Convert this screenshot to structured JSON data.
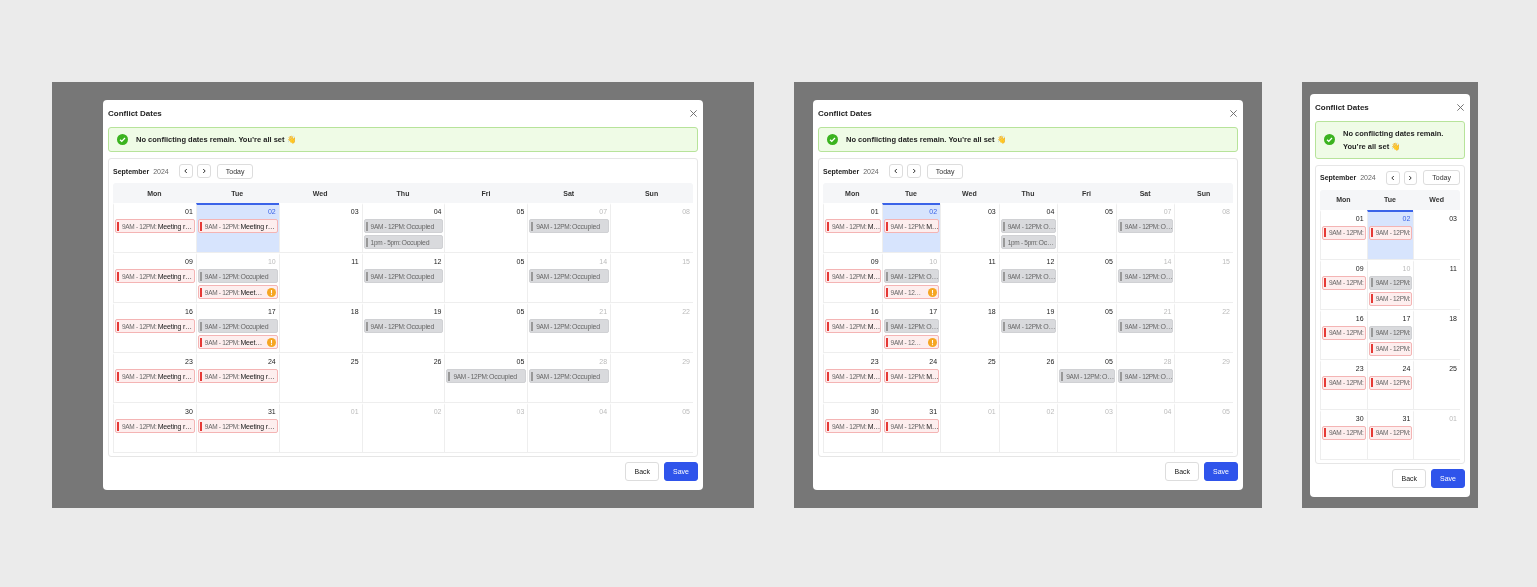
{
  "panels": [
    {
      "dialog": {
        "title": "Conflict Dates",
        "banner": "No conflicting dates remain. You’re all set 👋",
        "calendar": {
          "month": "September",
          "year": "2024",
          "today": "Today",
          "weekdays": [
            "Mon",
            "Tue",
            "Wed",
            "Thu",
            "Fri",
            "Sat",
            "Sun"
          ],
          "weeks": [
            {
              "days": [
                {
                  "day": "01",
                  "muted": false,
                  "selected": false,
                  "events": [
                    {
                      "kind": "conflict",
                      "time": "9AM - 12PM:",
                      "title": "Meeting r…"
                    }
                  ]
                },
                {
                  "day": "02",
                  "muted": false,
                  "selected": true,
                  "events": [
                    {
                      "kind": "conflict",
                      "time": "9AM - 12PM:",
                      "title": "Meeting r…"
                    }
                  ]
                },
                {
                  "day": "03",
                  "muted": false,
                  "selected": false
                },
                {
                  "day": "04",
                  "muted": false,
                  "selected": false,
                  "events": [
                    {
                      "kind": "occupied",
                      "time": "9AM - 12PM:",
                      "title": "Occupied"
                    },
                    {
                      "kind": "occupied",
                      "time": "1pm - 5pm:",
                      "title": "Occupied"
                    }
                  ]
                },
                {
                  "day": "05",
                  "muted": false,
                  "selected": false
                },
                {
                  "day": "07",
                  "muted": true,
                  "selected": false,
                  "events": [
                    {
                      "kind": "occupied",
                      "time": "9AM - 12PM:",
                      "title": "Occupied"
                    }
                  ]
                },
                {
                  "day": "08",
                  "muted": true,
                  "selected": false
                }
              ]
            },
            {
              "days": [
                {
                  "day": "09",
                  "muted": false,
                  "selected": false,
                  "events": [
                    {
                      "kind": "conflict",
                      "time": "9AM - 12PM:",
                      "title": "Meeting r…"
                    }
                  ]
                },
                {
                  "day": "10",
                  "muted": true,
                  "selected": false,
                  "events": [
                    {
                      "kind": "occupied",
                      "time": "9AM - 12PM:",
                      "title": "Occupied"
                    },
                    {
                      "kind": "conflict",
                      "time": "9AM - 12PM:",
                      "title": "Meet…",
                      "warning": true
                    }
                  ]
                },
                {
                  "day": "11",
                  "muted": false,
                  "selected": false
                },
                {
                  "day": "12",
                  "muted": false,
                  "selected": false,
                  "events": [
                    {
                      "kind": "occupied",
                      "time": "9AM - 12PM:",
                      "title": "Occupied"
                    }
                  ]
                },
                {
                  "day": "05",
                  "muted": false,
                  "selected": false
                },
                {
                  "day": "14",
                  "muted": true,
                  "selected": false,
                  "events": [
                    {
                      "kind": "occupied",
                      "time": "9AM - 12PM:",
                      "title": "Occupied"
                    }
                  ]
                },
                {
                  "day": "15",
                  "muted": true,
                  "selected": false
                }
              ]
            },
            {
              "days": [
                {
                  "day": "16",
                  "muted": false,
                  "selected": false,
                  "events": [
                    {
                      "kind": "conflict",
                      "time": "9AM - 12PM:",
                      "title": "Meeting r…"
                    }
                  ]
                },
                {
                  "day": "17",
                  "muted": false,
                  "selected": false,
                  "events": [
                    {
                      "kind": "occupied",
                      "time": "9AM - 12PM:",
                      "title": "Occupied"
                    },
                    {
                      "kind": "conflict",
                      "time": "9AM - 12PM:",
                      "title": "Meet…",
                      "warning": true
                    }
                  ]
                },
                {
                  "day": "18",
                  "muted": false,
                  "selected": false
                },
                {
                  "day": "19",
                  "muted": false,
                  "selected": false,
                  "events": [
                    {
                      "kind": "occupied",
                      "time": "9AM - 12PM:",
                      "title": "Occupied"
                    }
                  ]
                },
                {
                  "day": "05",
                  "muted": false,
                  "selected": false
                },
                {
                  "day": "21",
                  "muted": true,
                  "selected": false,
                  "events": [
                    {
                      "kind": "occupied",
                      "time": "9AM - 12PM:",
                      "title": "Occupied"
                    }
                  ]
                },
                {
                  "day": "22",
                  "muted": true,
                  "selected": false
                }
              ]
            },
            {
              "days": [
                {
                  "day": "23",
                  "muted": false,
                  "selected": false,
                  "events": [
                    {
                      "kind": "conflict",
                      "time": "9AM - 12PM:",
                      "title": "Meeting r…"
                    }
                  ]
                },
                {
                  "day": "24",
                  "muted": false,
                  "selected": false,
                  "events": [
                    {
                      "kind": "conflict",
                      "time": "9AM - 12PM:",
                      "title": "Meeting r…"
                    }
                  ]
                },
                {
                  "day": "25",
                  "muted": false,
                  "selected": false
                },
                {
                  "day": "26",
                  "muted": false,
                  "selected": false
                },
                {
                  "day": "05",
                  "muted": false,
                  "selected": false,
                  "events": [
                    {
                      "kind": "occupied",
                      "time": "9AM - 12PM:",
                      "title": "Occupied"
                    }
                  ]
                },
                {
                  "day": "28",
                  "muted": true,
                  "selected": false,
                  "events": [
                    {
                      "kind": "occupied",
                      "time": "9AM - 12PM:",
                      "title": "Occupied"
                    }
                  ]
                },
                {
                  "day": "29",
                  "muted": true,
                  "selected": false
                }
              ]
            },
            {
              "days": [
                {
                  "day": "30",
                  "muted": false,
                  "selected": false,
                  "events": [
                    {
                      "kind": "conflict",
                      "time": "9AM - 12PM:",
                      "title": "Meeting r…"
                    }
                  ]
                },
                {
                  "day": "31",
                  "muted": false,
                  "selected": false,
                  "events": [
                    {
                      "kind": "conflict",
                      "time": "9AM - 12PM:",
                      "title": "Meeting r…"
                    }
                  ]
                },
                {
                  "day": "01",
                  "muted": true,
                  "selected": false
                },
                {
                  "day": "02",
                  "muted": true,
                  "selected": false
                },
                {
                  "day": "03",
                  "muted": true,
                  "selected": false
                },
                {
                  "day": "04",
                  "muted": true,
                  "selected": false
                },
                {
                  "day": "05",
                  "muted": true,
                  "selected": false
                }
              ]
            }
          ]
        },
        "buttons": [
          "Back",
          "Save"
        ]
      }
    },
    {
      "dialog": {
        "title": "Conflict Dates",
        "banner": "No conflicting dates remain. You’re all set 👋",
        "calendar": {
          "month": "September",
          "year": "2024",
          "today": "Today",
          "weekdays": [
            "Mon",
            "Tue",
            "Wed",
            "Thu",
            "Fri",
            "Sat",
            "Sun"
          ],
          "weeks": [
            {
              "days": [
                {
                  "day": "01",
                  "muted": false,
                  "selected": false,
                  "events": [
                    {
                      "kind": "conflict",
                      "time": "9AM - 12PM:",
                      "title": "M…"
                    }
                  ]
                },
                {
                  "day": "02",
                  "muted": false,
                  "selected": true,
                  "events": [
                    {
                      "kind": "conflict",
                      "time": "9AM - 12PM:",
                      "title": "M…"
                    }
                  ]
                },
                {
                  "day": "03",
                  "muted": false,
                  "selected": false
                },
                {
                  "day": "04",
                  "muted": false,
                  "selected": false,
                  "events": [
                    {
                      "kind": "occupied",
                      "time": "9AM - 12PM:",
                      "title": "O…"
                    },
                    {
                      "kind": "occupied",
                      "time": "1pm - 5pm:",
                      "title": "Oc…"
                    }
                  ]
                },
                {
                  "day": "05",
                  "muted": false,
                  "selected": false
                },
                {
                  "day": "07",
                  "muted": true,
                  "selected": false,
                  "events": [
                    {
                      "kind": "occupied",
                      "time": "9AM - 12PM:",
                      "title": "O…"
                    }
                  ]
                },
                {
                  "day": "08",
                  "muted": true,
                  "selected": false
                }
              ]
            },
            {
              "days": [
                {
                  "day": "09",
                  "muted": false,
                  "selected": false,
                  "events": [
                    {
                      "kind": "conflict",
                      "time": "9AM - 12PM:",
                      "title": "M…"
                    }
                  ]
                },
                {
                  "day": "10",
                  "muted": true,
                  "selected": false,
                  "events": [
                    {
                      "kind": "occupied",
                      "time": "9AM - 12PM:",
                      "title": "O…"
                    },
                    {
                      "kind": "conflict",
                      "time": "9AM - 12…",
                      "warning": true
                    }
                  ]
                },
                {
                  "day": "11",
                  "muted": false,
                  "selected": false
                },
                {
                  "day": "12",
                  "muted": false,
                  "selected": false,
                  "events": [
                    {
                      "kind": "occupied",
                      "time": "9AM - 12PM:",
                      "title": "O…"
                    }
                  ]
                },
                {
                  "day": "05",
                  "muted": false,
                  "selected": false
                },
                {
                  "day": "14",
                  "muted": true,
                  "selected": false,
                  "events": [
                    {
                      "kind": "occupied",
                      "time": "9AM - 12PM:",
                      "title": "O…"
                    }
                  ]
                },
                {
                  "day": "15",
                  "muted": true,
                  "selected": false
                }
              ]
            },
            {
              "days": [
                {
                  "day": "16",
                  "muted": false,
                  "selected": false,
                  "events": [
                    {
                      "kind": "conflict",
                      "time": "9AM - 12PM:",
                      "title": "M…"
                    }
                  ]
                },
                {
                  "day": "17",
                  "muted": false,
                  "selected": false,
                  "events": [
                    {
                      "kind": "occupied",
                      "time": "9AM - 12PM:",
                      "title": "O…"
                    },
                    {
                      "kind": "conflict",
                      "time": "9AM - 12…",
                      "warning": true
                    }
                  ]
                },
                {
                  "day": "18",
                  "muted": false,
                  "selected": false
                },
                {
                  "day": "19",
                  "muted": false,
                  "selected": false,
                  "events": [
                    {
                      "kind": "occupied",
                      "time": "9AM - 12PM:",
                      "title": "O…"
                    }
                  ]
                },
                {
                  "day": "05",
                  "muted": false,
                  "selected": false
                },
                {
                  "day": "21",
                  "muted": true,
                  "selected": false,
                  "events": [
                    {
                      "kind": "occupied",
                      "time": "9AM - 12PM:",
                      "title": "O…"
                    }
                  ]
                },
                {
                  "day": "22",
                  "muted": true,
                  "selected": false
                }
              ]
            },
            {
              "days": [
                {
                  "day": "23",
                  "muted": false,
                  "selected": false,
                  "events": [
                    {
                      "kind": "conflict",
                      "time": "9AM - 12PM:",
                      "title": "M…"
                    }
                  ]
                },
                {
                  "day": "24",
                  "muted": false,
                  "selected": false,
                  "events": [
                    {
                      "kind": "conflict",
                      "time": "9AM - 12PM:",
                      "title": "M…"
                    }
                  ]
                },
                {
                  "day": "25",
                  "muted": false,
                  "selected": false
                },
                {
                  "day": "26",
                  "muted": false,
                  "selected": false
                },
                {
                  "day": "05",
                  "muted": false,
                  "selected": false,
                  "events": [
                    {
                      "kind": "occupied",
                      "time": "9AM - 12PM:",
                      "title": "O…"
                    }
                  ]
                },
                {
                  "day": "28",
                  "muted": true,
                  "selected": false,
                  "events": [
                    {
                      "kind": "occupied",
                      "time": "9AM - 12PM:",
                      "title": "O…"
                    }
                  ]
                },
                {
                  "day": "29",
                  "muted": true,
                  "selected": false
                }
              ]
            },
            {
              "days": [
                {
                  "day": "30",
                  "muted": false,
                  "selected": false,
                  "events": [
                    {
                      "kind": "conflict",
                      "time": "9AM - 12PM:",
                      "title": "M…"
                    }
                  ]
                },
                {
                  "day": "31",
                  "muted": false,
                  "selected": false,
                  "events": [
                    {
                      "kind": "conflict",
                      "time": "9AM - 12PM:",
                      "title": "M…"
                    }
                  ]
                },
                {
                  "day": "01",
                  "muted": true,
                  "selected": false
                },
                {
                  "day": "02",
                  "muted": true,
                  "selected": false
                },
                {
                  "day": "03",
                  "muted": true,
                  "selected": false
                },
                {
                  "day": "04",
                  "muted": true,
                  "selected": false
                },
                {
                  "day": "05",
                  "muted": true,
                  "selected": false
                }
              ]
            }
          ]
        },
        "buttons": [
          "Back",
          "Save"
        ]
      }
    },
    {
      "dialog": {
        "title": "Conflict Dates",
        "banner": "No conflicting dates remain. You’re all set 👋",
        "calendar": {
          "month": "September",
          "year": "2024",
          "today": "Today",
          "weekdays": [
            "Mon",
            "Tue",
            "Wed"
          ],
          "weeks": [
            {
              "days": [
                {
                  "day": "01",
                  "muted": false,
                  "selected": false,
                  "events": [
                    {
                      "kind": "conflict",
                      "time": "9AM - 12PM:"
                    }
                  ]
                },
                {
                  "day": "02",
                  "muted": false,
                  "selected": true,
                  "events": [
                    {
                      "kind": "conflict",
                      "time": "9AM - 12PM:"
                    }
                  ]
                },
                {
                  "day": "03",
                  "muted": false,
                  "selected": false
                }
              ]
            },
            {
              "days": [
                {
                  "day": "09",
                  "muted": false,
                  "selected": false,
                  "events": [
                    {
                      "kind": "conflict",
                      "time": "9AM - 12PM:"
                    }
                  ]
                },
                {
                  "day": "10",
                  "muted": true,
                  "selected": false,
                  "events": [
                    {
                      "kind": "occupied",
                      "time": "9AM - 12PM:"
                    },
                    {
                      "kind": "conflict",
                      "time": "9AM - 12PM:"
                    }
                  ]
                },
                {
                  "day": "11",
                  "muted": false,
                  "selected": false
                }
              ]
            },
            {
              "days": [
                {
                  "day": "16",
                  "muted": false,
                  "selected": false,
                  "events": [
                    {
                      "kind": "conflict",
                      "time": "9AM - 12PM:"
                    }
                  ]
                },
                {
                  "day": "17",
                  "muted": false,
                  "selected": false,
                  "events": [
                    {
                      "kind": "occupied",
                      "time": "9AM - 12PM:"
                    },
                    {
                      "kind": "conflict",
                      "time": "9AM - 12PM:"
                    }
                  ]
                },
                {
                  "day": "18",
                  "muted": false,
                  "selected": false
                }
              ]
            },
            {
              "days": [
                {
                  "day": "23",
                  "muted": false,
                  "selected": false,
                  "events": [
                    {
                      "kind": "conflict",
                      "time": "9AM - 12PM:"
                    }
                  ]
                },
                {
                  "day": "24",
                  "muted": false,
                  "selected": false,
                  "events": [
                    {
                      "kind": "conflict",
                      "time": "9AM - 12PM:"
                    }
                  ]
                },
                {
                  "day": "25",
                  "muted": false,
                  "selected": false
                }
              ]
            },
            {
              "days": [
                {
                  "day": "30",
                  "muted": false,
                  "selected": false,
                  "events": [
                    {
                      "kind": "conflict",
                      "time": "9AM - 12PM:"
                    }
                  ]
                },
                {
                  "day": "31",
                  "muted": false,
                  "selected": false,
                  "events": [
                    {
                      "kind": "conflict",
                      "time": "9AM - 12PM:"
                    }
                  ]
                },
                {
                  "day": "01",
                  "muted": true,
                  "selected": false
                }
              ]
            }
          ]
        },
        "buttons": [
          "Back",
          "Save"
        ]
      }
    }
  ]
}
